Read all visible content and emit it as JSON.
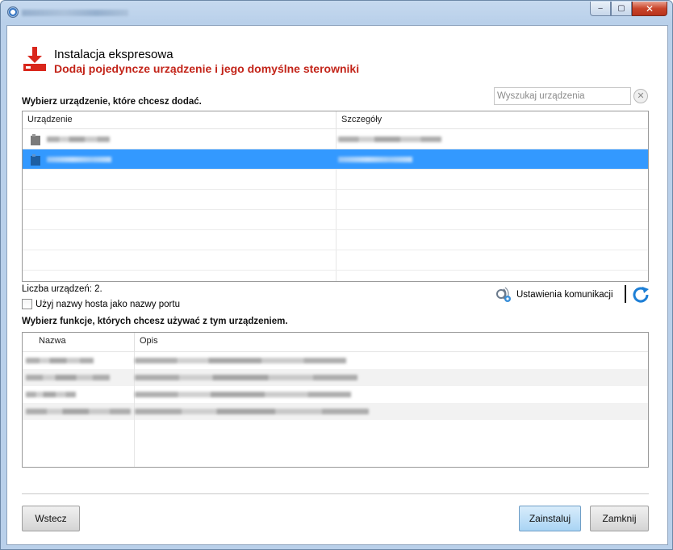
{
  "window": {
    "controls": {
      "minimize": "‒",
      "maximize": "▢",
      "close": "✕"
    }
  },
  "header": {
    "title": "Instalacja ekspresowa",
    "subtitle": "Dodaj pojedyncze urządzenie i jego domyślne sterowniki"
  },
  "search": {
    "placeholder": "Wyszukaj urządzenia",
    "clear_icon": "✕"
  },
  "devices": {
    "label": "Wybierz urządzenie, które chcesz dodać.",
    "columns": [
      "Urządzenie",
      "Szczegóły"
    ],
    "selected_index": 1,
    "count_text": "Liczba urządzeń: 2."
  },
  "options": {
    "use_hostname_label": "Użyj nazwy hosta jako nazwy portu",
    "use_hostname_checked": false
  },
  "communication": {
    "label": "Ustawienia komunikacji"
  },
  "functions": {
    "label": "Wybierz funkcje, których chcesz używać z tym urządzeniem.",
    "columns": [
      "Nazwa",
      "Opis"
    ]
  },
  "footer": {
    "back": "Wstecz",
    "install": "Zainstaluj",
    "close": "Zamknij"
  },
  "colors": {
    "accent_red": "#c3251a",
    "selection_blue": "#3399ff"
  }
}
